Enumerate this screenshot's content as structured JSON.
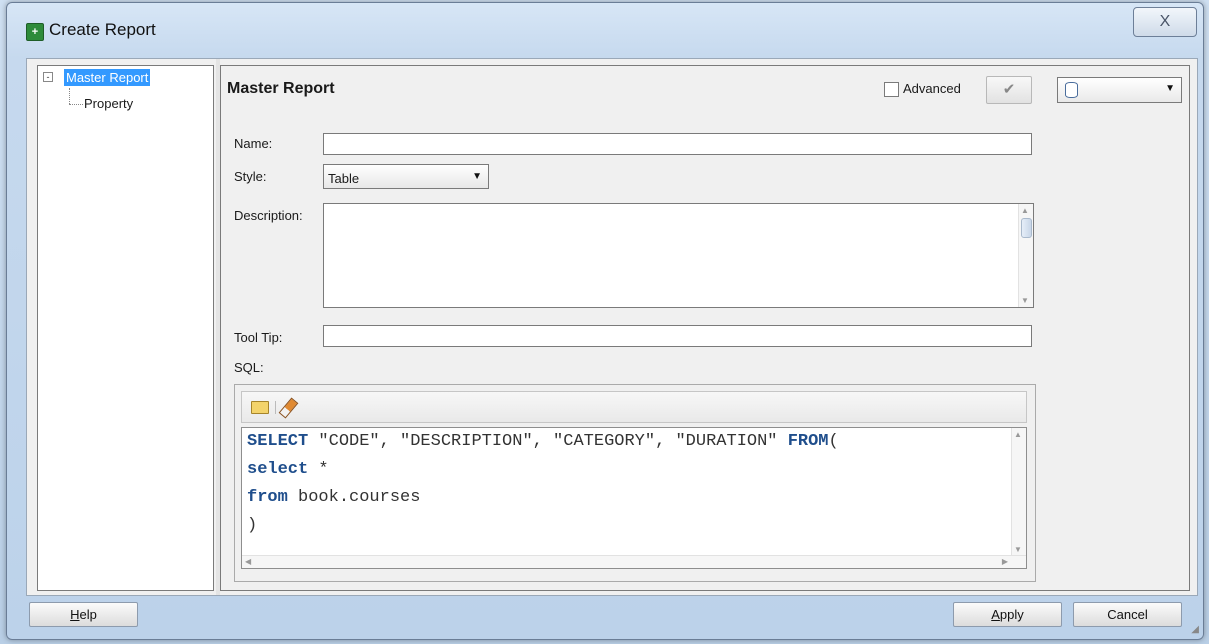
{
  "window": {
    "title": "Create Report",
    "close_glyph": "X"
  },
  "tree": {
    "root_label": "Master Report",
    "child_label": "Property",
    "expander_glyph": "-"
  },
  "panel": {
    "title": "Master Report",
    "advanced_label": "Advanced",
    "advanced_checked": false,
    "connection_value": ""
  },
  "form": {
    "name_label": "Name:",
    "name_value": "",
    "style_label": "Style:",
    "style_value": "Table",
    "description_label": "Description:",
    "description_value": "",
    "tooltip_label": "Tool Tip:",
    "tooltip_value": "",
    "sql_label": "SQL:"
  },
  "sql": {
    "line1_kw1": "SELECT",
    "line1_mid": " \"CODE\", \"DESCRIPTION\", \"CATEGORY\", \"DURATION\" ",
    "line1_kw2": "FROM",
    "line1_end": "(",
    "line2_kw": "select",
    "line2_rest": " *",
    "line3_kw": "from",
    "line3_rest": " book.courses",
    "line4": ")"
  },
  "buttons": {
    "help_mnemonic": "H",
    "help_rest": "elp",
    "apply_mnemonic": "A",
    "apply_rest": "pply",
    "cancel": "Cancel"
  }
}
